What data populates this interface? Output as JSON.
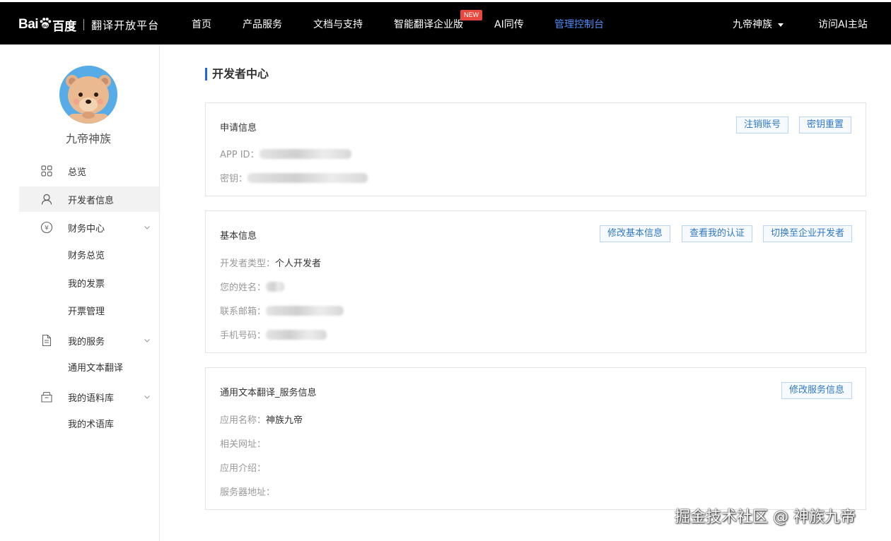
{
  "header": {
    "logo_bai": "Bai",
    "logo_du": "百度",
    "platform": "翻译开放平台",
    "nav": [
      "首页",
      "产品服务",
      "文档与支持",
      "智能翻译企业版",
      "AI同传",
      "管理控制台"
    ],
    "new_badge": "NEW",
    "user": "九帝神族",
    "visit": "访问AI主站",
    "active_color": "#4e8cf7"
  },
  "sidebar": {
    "username": "九帝神族",
    "items": [
      {
        "label": "总览",
        "icon": "grid-icon"
      },
      {
        "label": "开发者信息",
        "icon": "user-icon"
      },
      {
        "label": "财务中心",
        "icon": "yen-icon"
      },
      {
        "label": "财务总览"
      },
      {
        "label": "我的发票"
      },
      {
        "label": "开票管理"
      },
      {
        "label": "我的服务",
        "icon": "document-icon"
      },
      {
        "label": "通用文本翻译"
      },
      {
        "label": "我的语料库",
        "icon": "box-icon"
      },
      {
        "label": "我的术语库"
      }
    ]
  },
  "main": {
    "title": "开发者中心",
    "apply": {
      "title": "申请信息",
      "buttons": [
        "注销账号",
        "密钥重置"
      ],
      "app_id_label": "APP ID：",
      "key_label": "密钥："
    },
    "basic": {
      "title": "基本信息",
      "buttons": [
        "修改基本信息",
        "查看我的认证",
        "切换至企业开发者"
      ],
      "type_label": "开发者类型：",
      "type_value": "个人开发者",
      "name_label": "您的姓名：",
      "email_label": "联系邮箱：",
      "phone_label": "手机号码："
    },
    "service": {
      "title": "通用文本翻译_服务信息",
      "buttons": [
        "修改服务信息"
      ],
      "app_name_label": "应用名称：",
      "app_name_value": "神族九帝",
      "url_label": "相关网址：",
      "intro_label": "应用介绍：",
      "server_label": "服务器地址："
    }
  },
  "watermark": "掘金技术社区 @ 神族九帝"
}
